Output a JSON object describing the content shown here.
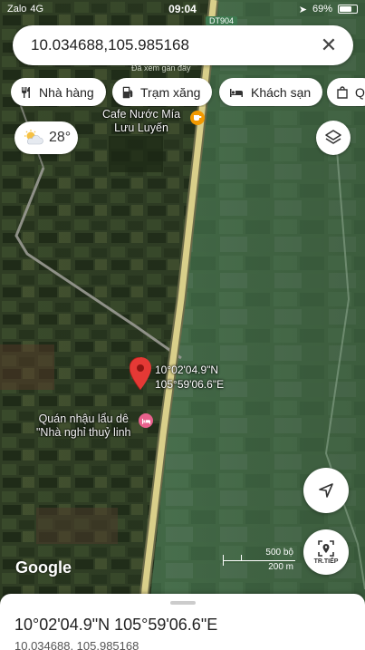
{
  "status": {
    "carrier": "Zalo",
    "network": "4G",
    "time": "09:04",
    "battery": "69%",
    "road_tag": "DT904"
  },
  "search": {
    "query": "10.034688,105.985168",
    "recent_hint": "Đã xem gần đây"
  },
  "chips": [
    {
      "label": "Nhà hàng",
      "icon": "restaurant-icon"
    },
    {
      "label": "Trạm xăng",
      "icon": "gas-station-icon"
    },
    {
      "label": "Khách sạn",
      "icon": "hotel-icon"
    },
    {
      "label": "Q",
      "icon": "shopping-icon"
    }
  ],
  "weather": {
    "temp": "28°",
    "icon": "partly-cloudy-icon"
  },
  "map": {
    "poi_cafe": [
      "Cafe Nước Mía",
      "Lưu Luyến"
    ],
    "poi_hotel": [
      "Quán nhậu lẩu dê",
      "\"Nhà nghỉ thuỷ linh"
    ],
    "pin_coords": [
      "10°02'04.9\"N",
      "105°59'06.6\"E"
    ]
  },
  "next_button": "TR.TIẾP",
  "logo": "Google",
  "scale": {
    "top": "500 bộ",
    "bottom": "200 m"
  },
  "sheet": {
    "title": "10°02'04.9\"N 105°59'06.6\"E",
    "subtitle": "10.034688, 105.985168"
  },
  "colors": {
    "pin": "#e53935",
    "cafe_poi": "#f29900",
    "hotel_poi": "#e8618c",
    "road": "#d9cf8a"
  }
}
